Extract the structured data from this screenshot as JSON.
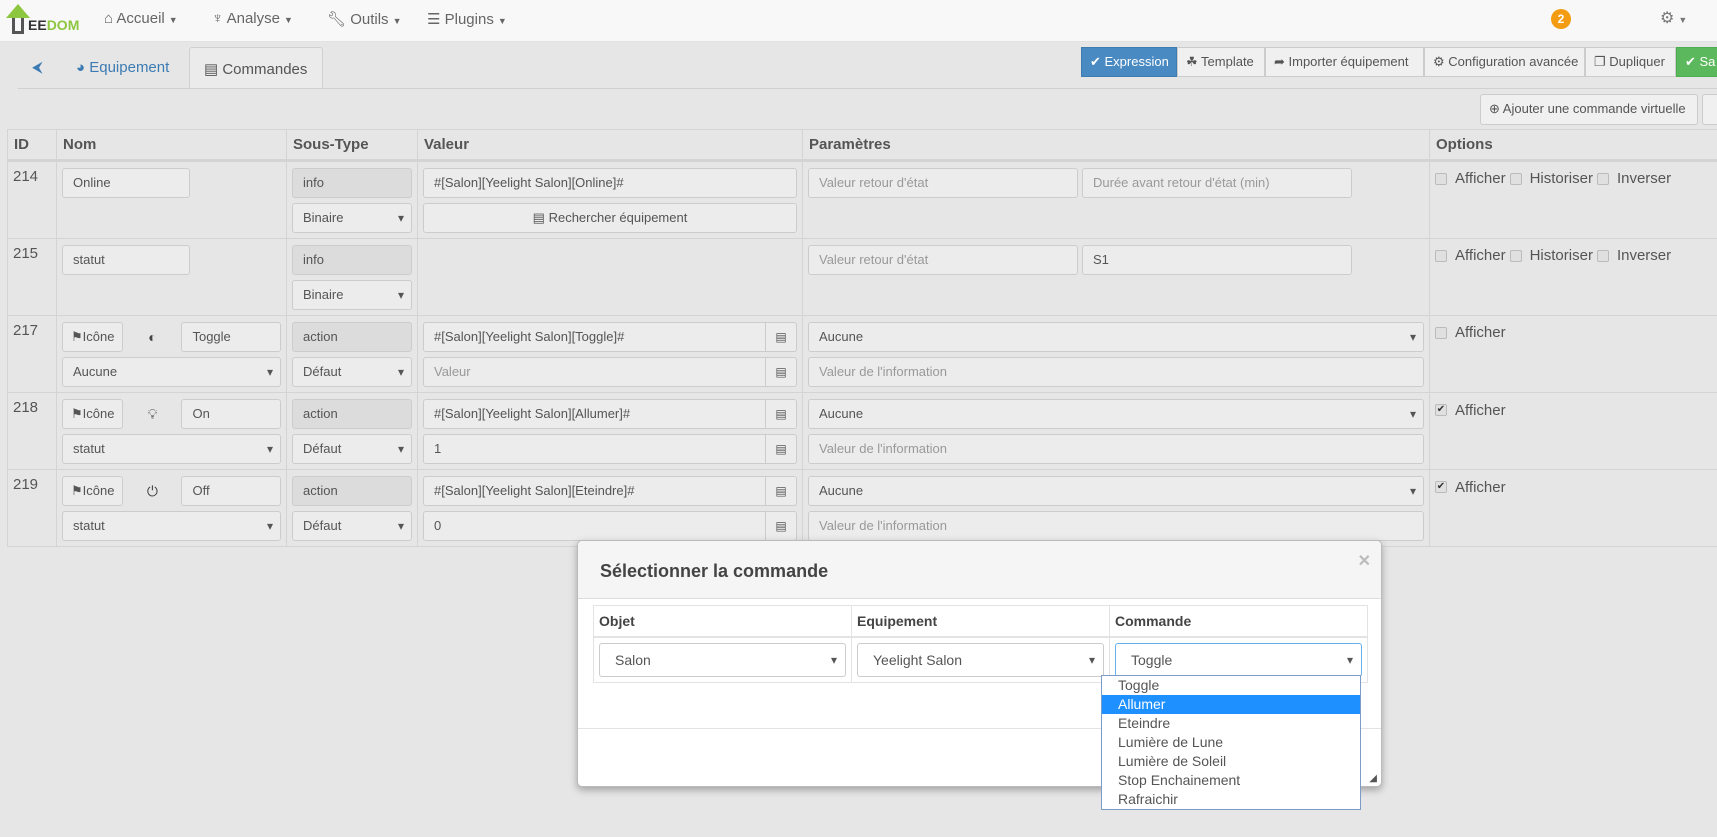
{
  "navbar": {
    "logo_text": "JEEDOM",
    "items": [
      {
        "label": "Accueil",
        "icon": "home-icon"
      },
      {
        "label": "Analyse",
        "icon": "stethoscope-icon"
      },
      {
        "label": "Outils",
        "icon": "wrench-icon"
      },
      {
        "label": "Plugins",
        "icon": "tasks-icon"
      }
    ],
    "notification_count": "2"
  },
  "tabs": [
    {
      "label": "",
      "icon": "back-arrow-icon"
    },
    {
      "label": "Equipement",
      "icon": "dashboard-icon"
    },
    {
      "label": "Commandes",
      "icon": "list-icon",
      "active": true
    }
  ],
  "toolbar": {
    "expression": "Expression",
    "template": "Template",
    "import": "Importer équipement",
    "advanced": "Configuration avancée",
    "duplicate": "Dupliquer",
    "save": "Sa",
    "add_virtual": "Ajouter une commande virtuelle"
  },
  "table": {
    "headers": [
      "ID",
      "Nom",
      "Sous-Type",
      "Valeur",
      "Paramètres",
      "Options"
    ],
    "rows": [
      {
        "id": "214",
        "kind": "info",
        "name": "Online",
        "subtype": "info",
        "subtype_select": "Binaire",
        "value": "#[Salon][Yeelight Salon][Online]#",
        "search_button": "Rechercher équipement",
        "params": [
          {
            "placeholder": "Valeur retour d'état",
            "value": ""
          },
          {
            "placeholder": "Durée avant retour d'état (min)",
            "value": ""
          }
        ],
        "options": [
          {
            "label": "Afficher",
            "checked": false
          },
          {
            "label": "Historiser",
            "checked": false
          },
          {
            "label": "Inverser",
            "checked": false
          }
        ]
      },
      {
        "id": "215",
        "kind": "info",
        "name": "statut",
        "subtype": "info",
        "subtype_select": "Binaire",
        "params": [
          {
            "placeholder": "Valeur retour d'état",
            "value": ""
          },
          {
            "placeholder": "",
            "value": "S1"
          }
        ],
        "options": [
          {
            "label": "Afficher",
            "checked": false
          },
          {
            "label": "Historiser",
            "checked": false
          },
          {
            "label": "Inverser",
            "checked": false
          }
        ]
      },
      {
        "id": "217",
        "kind": "action",
        "icon_button": "Icône",
        "icon": "toggle-icon",
        "name": "Toggle",
        "info_select": "Aucune",
        "subtype": "action",
        "subtype_select": "Défaut",
        "value": "#[Salon][Yeelight Salon][Toggle]#",
        "value2": {
          "placeholder": "Valeur",
          "value": ""
        },
        "param_select": "Aucune",
        "param_placeholder": "Valeur de l'information",
        "options": [
          {
            "label": "Afficher",
            "checked": false
          }
        ]
      },
      {
        "id": "218",
        "kind": "action",
        "icon_button": "Icône",
        "icon": "lightbulb-icon",
        "name": "On",
        "info_select": "statut",
        "subtype": "action",
        "subtype_select": "Défaut",
        "value": "#[Salon][Yeelight Salon][Allumer]#",
        "value2": {
          "placeholder": "",
          "value": "1"
        },
        "param_select": "Aucune",
        "param_placeholder": "Valeur de l'information",
        "options": [
          {
            "label": "Afficher",
            "checked": true
          }
        ]
      },
      {
        "id": "219",
        "kind": "action",
        "icon_button": "Icône",
        "icon": "power-icon",
        "name": "Off",
        "info_select": "statut",
        "subtype": "action",
        "subtype_select": "Défaut",
        "value": "#[Salon][Yeelight Salon][Eteindre]#",
        "value2": {
          "placeholder": "",
          "value": "0"
        },
        "param_select": "Aucune",
        "param_placeholder": "Valeur de l'information",
        "options": [
          {
            "label": "Afficher",
            "checked": true
          }
        ]
      }
    ]
  },
  "modal": {
    "title": "Sélectionner la commande",
    "headers": [
      "Objet",
      "Equipement",
      "Commande"
    ],
    "objet": "Salon",
    "equipement": "Yeelight Salon",
    "commande": "Toggle",
    "commande_options": [
      "Toggle",
      "Allumer",
      "Eteindre",
      "Lumière de Lune",
      "Lumière de Soleil",
      "Stop Enchainement",
      "Rafraichir"
    ],
    "highlighted_option": "Allumer"
  },
  "colors": {
    "primary": "#4a8ac2",
    "success": "#5cb85c",
    "badge": "#f39c12",
    "highlight": "#1e90ff",
    "logo": "#8dc63f"
  }
}
